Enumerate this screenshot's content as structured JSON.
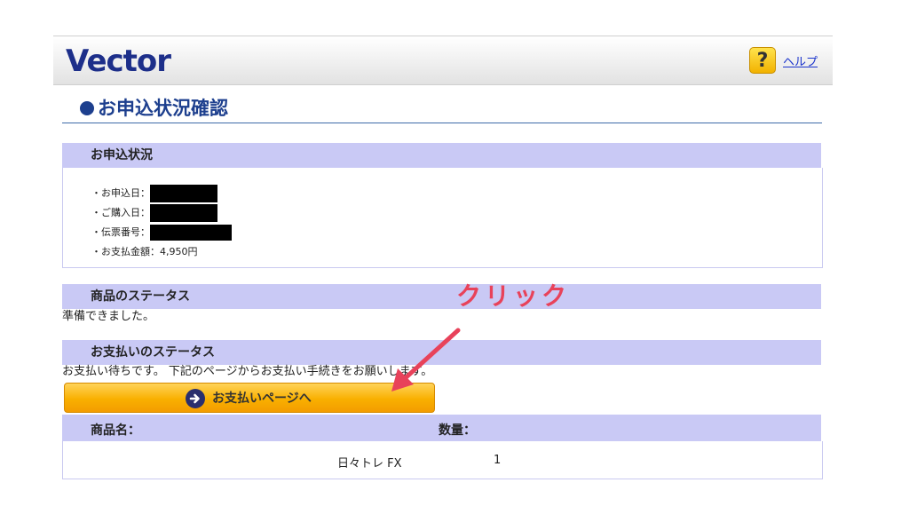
{
  "header": {
    "logo_text": "Vector",
    "help_icon_glyph": "?",
    "help_label": "ヘルプ"
  },
  "page_title": "お申込状況確認",
  "application_status": {
    "heading": "お申込状況",
    "items": [
      {
        "label": "・お申込日：",
        "value": ""
      },
      {
        "label": "・ご購入日：",
        "value": ""
      },
      {
        "label": "・伝票番号：",
        "value": ""
      },
      {
        "label": "・お支払金額：",
        "value": "4,950円"
      }
    ]
  },
  "product_status": {
    "heading": "商品のステータス",
    "text": "準備できました。"
  },
  "payment_status": {
    "heading": "お支払いのステータス",
    "text": "お支払い待ちです。 下記のページからお支払い手続きをお願いします。",
    "button_label": "お支払いページへ"
  },
  "products": {
    "columns": [
      "商品名：",
      "数量："
    ],
    "rows": [
      {
        "name": "日々トレ FX",
        "quantity": "1"
      }
    ]
  },
  "annotation": {
    "text": "クリック",
    "color": "#e8425a"
  },
  "colors": {
    "section_header_bg": "#c9c9f5",
    "title_blue": "#1d3f8e",
    "button_orange": "#f9b000"
  }
}
